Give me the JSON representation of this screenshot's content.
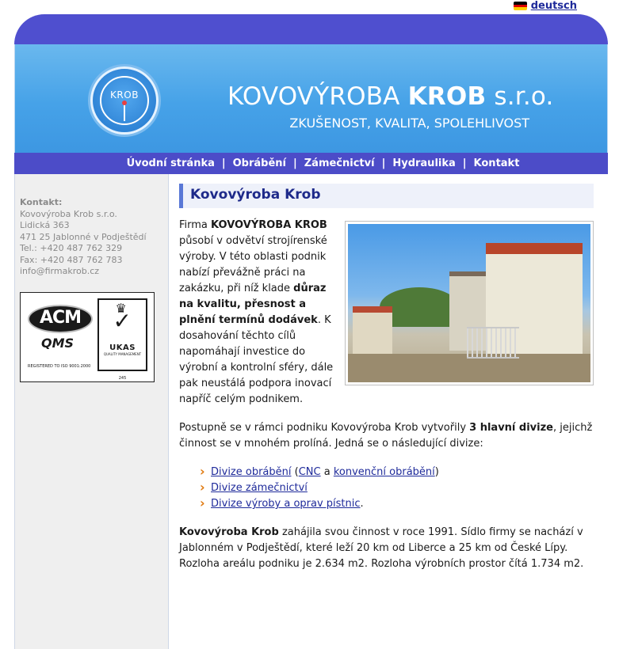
{
  "lang": {
    "label": "deutsch",
    "flag_colors": [
      "#000000",
      "#dd0000",
      "#ffce00"
    ]
  },
  "header": {
    "logo_text": "KROB",
    "title_prefix": "KOVOVÝROBA",
    "title_bold": "KROB",
    "title_suffix": "s.r.o.",
    "tagline": "ZKUŠENOST, KVALITA, SPOLEHLIVOST"
  },
  "nav": {
    "items": [
      "Úvodní stránka",
      "Obrábění",
      "Zámečnictví",
      "Hydraulika",
      "Kontakt"
    ],
    "separator": "|"
  },
  "sidebar": {
    "label": "Kontakt:",
    "lines": [
      "Kovovýroba Krob s.r.o.",
      "Lidická 363",
      "471 25 Jablonné v Podještědí",
      "Tel.: +420 487 762 329",
      "Fax: +420 487 762 783",
      "info@firmakrob.cz"
    ],
    "cert": {
      "acm": "ACM",
      "qms": "QMS",
      "reg": "REGISTERED TO ISO 9001:2000",
      "ukas": "UKAS",
      "ukas_sub": "QUALITY MANAGEMENT",
      "ukas_num": "245"
    }
  },
  "content": {
    "heading": "Kovovýroba Krob",
    "intro": {
      "t1": "Firma ",
      "b1": "KOVOVÝROBA KROB",
      "t2": " působí v odvětví strojírenské výroby. V této oblasti podnik nabízí převážně práci na zakázku, při níž klade ",
      "b2": "důraz na kvalitu, přesnost a plnění termínů dodávek",
      "t3": ". K dosahování těchto cílů napomáhají investice do výrobní a kontrolní sféry, dále pak neustálá podpora inovací napříč celým podnikem."
    },
    "divisions_intro": {
      "t1": "Postupně se v rámci podniku Kovovýroba Krob vytvořily ",
      "b1": "3 hlavní divize",
      "t2": ", jejichž činnost se v mnohém prolíná. Jedná se o následující divize:"
    },
    "divisions": {
      "d1": "Divize obrábění",
      "d1_open": " (",
      "d1_cnc": "CNC",
      "d1_and": " a ",
      "d1_conv": "konvenční obrábění",
      "d1_close": ")",
      "d2": "Divize zámečnictví",
      "d3": "Divize výroby a oprav pístnic",
      "d3_end": "."
    },
    "history": {
      "b1": "Kovovýroba Krob",
      "t1": " zahájila svou činnost v roce 1991. Sídlo firmy se nachází v Jablonném v Podještědí, které leží 20 km od Liberce a 25 km od České Lípy. Rozloha areálu podniku je 2.634 m2. Rozloha výrobních prostor čítá 1.734 m2."
    }
  }
}
